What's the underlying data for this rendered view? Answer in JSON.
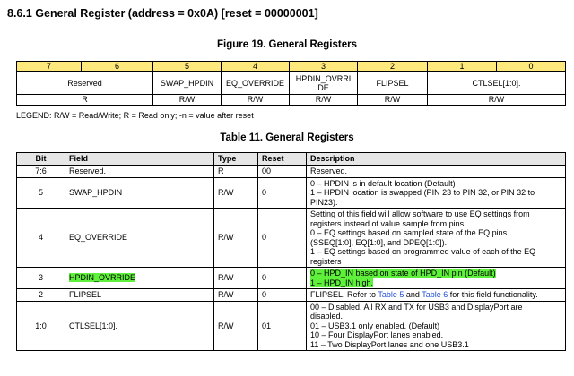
{
  "section_title": "8.6.1   General Register (address = 0x0A) [reset = 00000001]",
  "figure_title": "Figure 19.  General Registers",
  "register_map": {
    "bit_numbers": [
      "7",
      "6",
      "5",
      "4",
      "3",
      "2",
      "1",
      "0"
    ],
    "fields": [
      "Reserved",
      "SWAP_HPDIN",
      "EQ_OVERRIDE",
      "HPDIN_OVRRIDE",
      "FLIPSEL",
      "CTLSEL[1:0]."
    ],
    "access": [
      "R",
      "R/W",
      "R/W",
      "R/W",
      "R/W",
      "R/W"
    ]
  },
  "legend": "LEGEND: R/W = Read/Write; R = Read only; -n = value after reset",
  "table_title": "Table 11.  General Registers",
  "table": {
    "headers": [
      "Bit",
      "Field",
      "Type",
      "Reset",
      "Description"
    ],
    "rows": [
      {
        "bit": "7:6",
        "field": "Reserved.",
        "type": "R",
        "reset": "00",
        "desc": [
          "Reserved."
        ]
      },
      {
        "bit": "5",
        "field": "SWAP_HPDIN",
        "type": "R/W",
        "reset": "0",
        "desc": [
          "0 – HPDIN is in default location (Default)",
          "1 – HPDIN location is swapped (PIN 23 to PIN 32, or PIN 32 to",
          "PIN23)."
        ]
      },
      {
        "bit": "4",
        "field": "EQ_OVERRIDE",
        "type": "R/W",
        "reset": "0",
        "desc": [
          "Setting of this field will allow software to use EQ settings from",
          "registers instead of value sample from pins.",
          "0 – EQ settings based on sampled state of the EQ pins",
          "(SSEQ[1:0], EQ[1:0], and DPEQ[1:0]).",
          "1 – EQ settings based on programmed value of each of the EQ",
          "registers"
        ]
      },
      {
        "bit": "3",
        "field": "HPDIN_OVRRIDE",
        "type": "R/W",
        "reset": "0",
        "desc": [
          "0 – HPD_IN based on state of HPD_IN pin (Default)",
          "1 – HPD_IN high."
        ]
      },
      {
        "bit": "2",
        "field": "FLIPSEL",
        "type": "R/W",
        "reset": "0",
        "desc_parts": [
          "FLIPSEL. Refer to ",
          "Table 5",
          " and ",
          "Table 6",
          " for this field functionality."
        ]
      },
      {
        "bit": "1:0",
        "field": "CTLSEL[1:0].",
        "type": "R/W",
        "reset": "01",
        "desc": [
          "00 – Disabled. All RX and TX for USB3 and DisplayPort are",
          "disabled.",
          "01 – USB3.1 only enabled. (Default)",
          "10 – Four DisplayPort lanes enabled.",
          "11 – Two DisplayPort lanes and one USB3.1"
        ]
      }
    ]
  },
  "highlight_color": "#5ef03a",
  "link_color": "#1f4fd6"
}
